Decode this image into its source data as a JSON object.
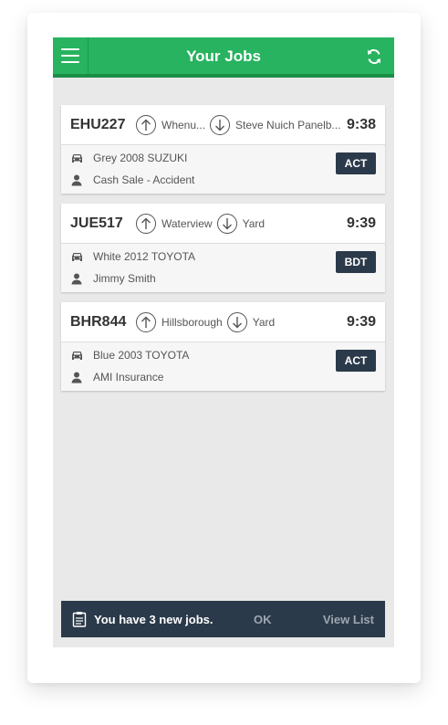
{
  "header": {
    "title": "Your Jobs",
    "menu_icon": "hamburger-menu-icon",
    "refresh_icon": "refresh-sync-icon",
    "accent_color": "#27b35f"
  },
  "jobs": [
    {
      "plate": "EHU227",
      "from": "Whenu...",
      "to": "Steve Nuich Panelb...",
      "time": "9:38",
      "vehicle": "Grey 2008 SUZUKI",
      "customer": "Cash Sale - Accident",
      "status": "ACT"
    },
    {
      "plate": "JUE517",
      "from": "Waterview",
      "to": "Yard",
      "time": "9:39",
      "vehicle": "White 2012 TOYOTA",
      "customer": "Jimmy Smith",
      "status": "BDT"
    },
    {
      "plate": "BHR844",
      "from": "Hillsborough",
      "to": "Yard",
      "time": "9:39",
      "vehicle": "Blue 2003 TOYOTA",
      "customer": "AMI Insurance",
      "status": "ACT"
    }
  ],
  "snackbar": {
    "message": "You have 3 new jobs.",
    "ok_label": "OK",
    "view_label": "View List",
    "icon": "clipboard-icon",
    "background": "#2b3a4a"
  }
}
